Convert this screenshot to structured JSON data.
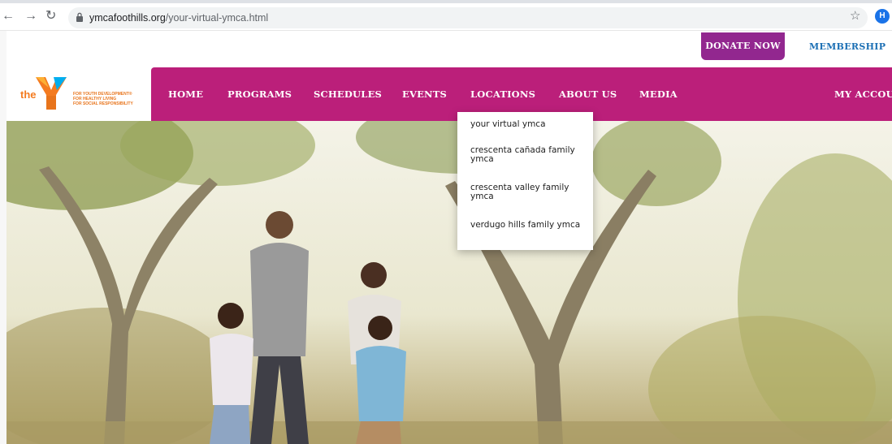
{
  "browser": {
    "url_domain": "ymcafoothills.org",
    "url_path": "/your-virtual-ymca.html",
    "profile_initial": "H",
    "back_icon": "arrow-left-icon",
    "forward_icon": "arrow-right-icon",
    "reload_icon": "reload-icon",
    "lock_icon": "lock-icon",
    "star_icon": "star-icon"
  },
  "utility_nav": {
    "donate_label": "DONATE NOW",
    "membership_label": "MEMBERSHIP"
  },
  "logo": {
    "prefix": "the",
    "tagline": [
      "FOR YOUTH DEVELOPMENT®",
      "FOR HEALTHY LIVING",
      "FOR SOCIAL RESPONSIBILITY"
    ]
  },
  "main_nav": {
    "items": [
      "HOME",
      "PROGRAMS",
      "SCHEDULES",
      "EVENTS",
      "LOCATIONS",
      "ABOUT US",
      "MEDIA"
    ],
    "account_label": "MY ACCOUNT"
  },
  "locations_dropdown": {
    "items": [
      "your virtual ymca",
      "crescenta cañada family ymca",
      "crescenta valley family ymca",
      "verdugo hills family ymca"
    ]
  },
  "colors": {
    "nav_bg": "#bb1f7a",
    "donate_bg": "#92278f",
    "membership_text": "#1b6fb4",
    "logo_orange": "#f47b20"
  }
}
